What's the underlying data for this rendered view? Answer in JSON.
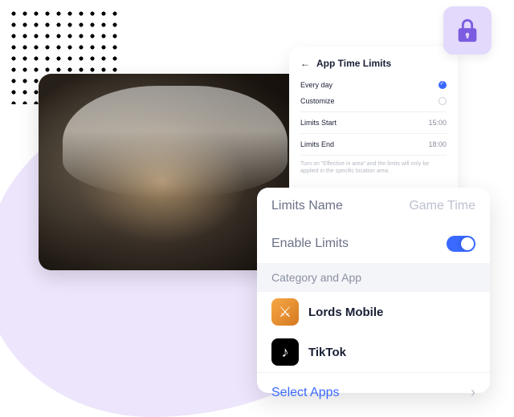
{
  "panel_back": {
    "title": "App Time Limits",
    "option_everyday": "Every day",
    "option_customize": "Customize",
    "limits_start_label": "Limits Start",
    "limits_start_value": "15:00",
    "limits_end_label": "Limits End",
    "limits_end_value": "18:00",
    "hint": "Turn on \"Effective in area\" and the limits will only be applied in the specific location area."
  },
  "panel_front": {
    "limits_name_label": "Limits Name",
    "limits_name_value": "Game Time",
    "enable_label": "Enable Limits",
    "section_header": "Category and App",
    "apps": [
      {
        "name": "Lords Mobile",
        "icon": "lords"
      },
      {
        "name": "TikTok",
        "icon": "tiktok"
      }
    ],
    "select_apps_label": "Select Apps"
  }
}
